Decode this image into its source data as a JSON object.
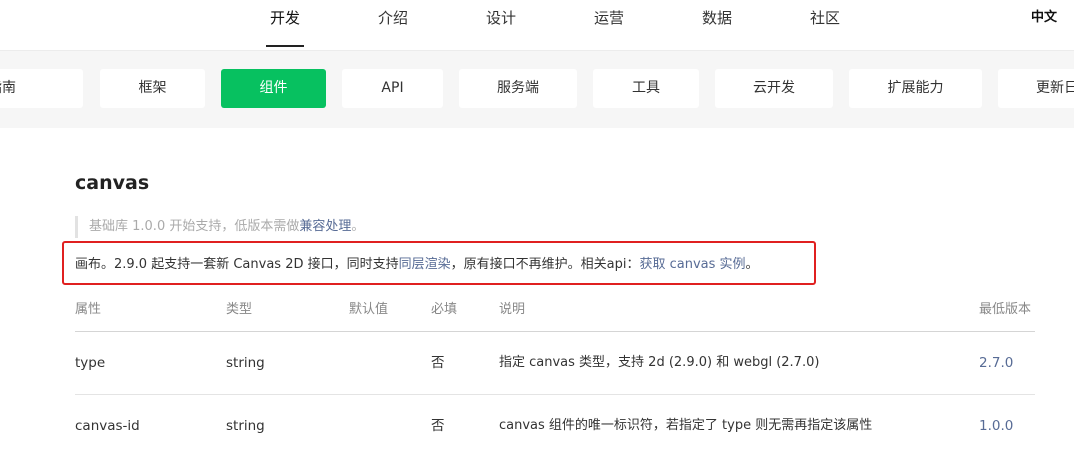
{
  "nav": {
    "items": [
      "开发",
      "介绍",
      "设计",
      "运营",
      "数据",
      "社区"
    ],
    "lang": "中文"
  },
  "categories": [
    "指南",
    "框架",
    "组件",
    "API",
    "服务端",
    "工具",
    "云开发",
    "扩展能力",
    "更新日"
  ],
  "content": {
    "title": "canvas",
    "quote_prefix": "基础库 1.0.0 开始支持，低版本需做",
    "quote_link": "兼容处理",
    "quote_suffix": "。",
    "desc_part1": "画布。2.9.0 起支持一套新 Canvas 2D 接口，同时支持",
    "desc_link1": "同层渲染",
    "desc_part2": "，原有接口不再维护。相关api：",
    "desc_link2": "获取 canvas 实例",
    "desc_part3": "。"
  },
  "table": {
    "headers": [
      "属性",
      "类型",
      "默认值",
      "必填",
      "说明",
      "最低版本"
    ],
    "rows": [
      {
        "prop": "type",
        "type": "string",
        "default": "",
        "required": "否",
        "desc": "指定 canvas 类型，支持 2d (2.9.0) 和 webgl (2.7.0)",
        "version": "2.7.0"
      },
      {
        "prop": "canvas-id",
        "type": "string",
        "default": "",
        "required": "否",
        "desc": "canvas 组件的唯一标识符，若指定了 type 则无需再指定该属性",
        "version": "1.0.0"
      }
    ]
  }
}
